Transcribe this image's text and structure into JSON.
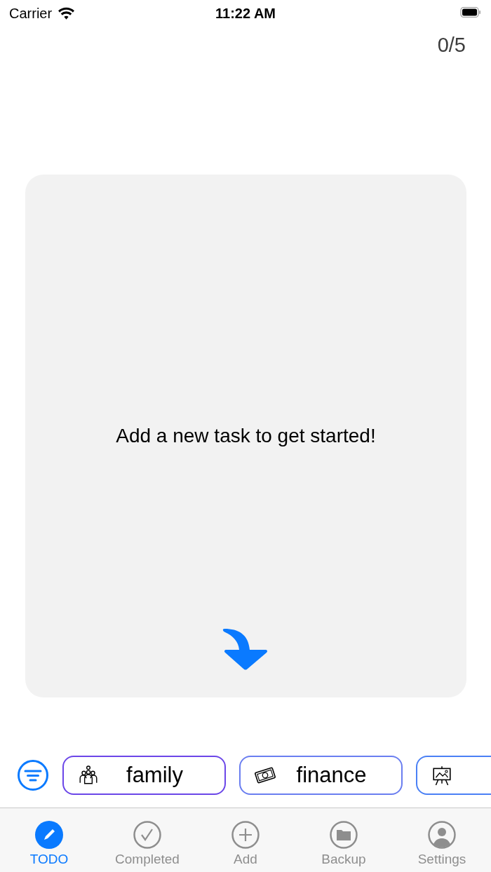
{
  "status_bar": {
    "carrier": "Carrier",
    "time": "11:22 AM"
  },
  "counter": "0/5",
  "card": {
    "message": "Add a new task to get started!"
  },
  "categories": [
    {
      "kind": "family",
      "label": "family",
      "color": "#6b46e8"
    },
    {
      "kind": "money",
      "label": "finance",
      "color": "#6a7ef0"
    },
    {
      "kind": "easel",
      "color": "#4a80f5"
    }
  ],
  "tabs": [
    {
      "kind": "pencil",
      "label": "TODO",
      "selected": true
    },
    {
      "kind": "check",
      "label": "Completed",
      "selected": false
    },
    {
      "kind": "plus",
      "label": "Add",
      "selected": false
    },
    {
      "kind": "folder",
      "label": "Backup",
      "selected": false
    },
    {
      "kind": "person",
      "label": "Settings",
      "selected": false
    }
  ]
}
